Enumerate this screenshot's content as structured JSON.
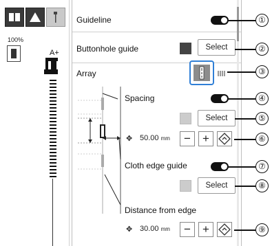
{
  "left_panel": {
    "zoom_percent": "100%",
    "presser_label": "A+"
  },
  "panel": {
    "guideline": {
      "label": "Guideline",
      "toggle_on": true
    },
    "buttonhole_guide": {
      "label": "Buttonhole guide",
      "swatch_color": "#444444",
      "select_label": "Select"
    },
    "array": {
      "label": "Array"
    },
    "spacing": {
      "label": "Spacing",
      "toggle_on": true,
      "swatch_color": "#cccccc",
      "select_label": "Select",
      "value": "50.00",
      "unit": "mm"
    },
    "cloth_edge": {
      "label": "Cloth edge guide",
      "toggle_on": true,
      "swatch_color": "#cccccc",
      "select_label": "Select"
    },
    "distance": {
      "label": "Distance from edge",
      "value": "30.00",
      "unit": "mm"
    },
    "minus": "−",
    "plus": "+"
  },
  "callouts": [
    "①",
    "②",
    "③",
    "④",
    "⑤",
    "⑥",
    "⑦",
    "⑧",
    "⑨"
  ],
  "colors": {
    "array_highlight": "#2f7fd6"
  }
}
